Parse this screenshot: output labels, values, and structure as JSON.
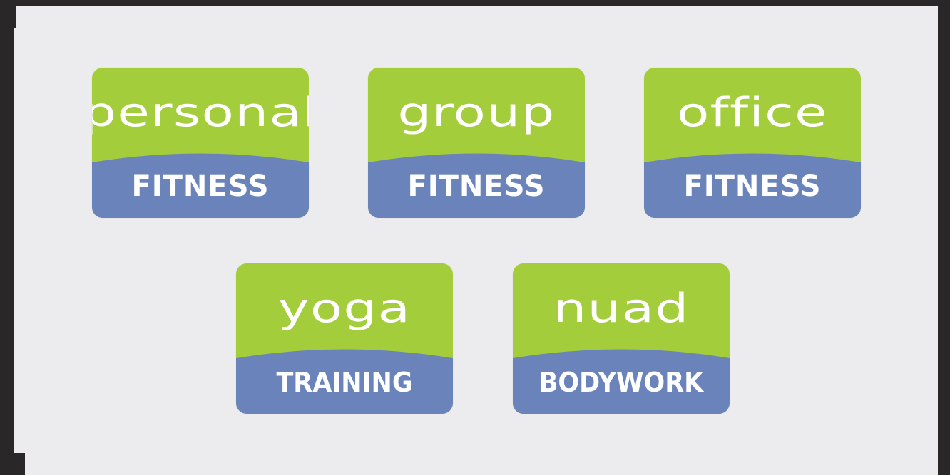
{
  "colors": {
    "green": "#a3cd3b",
    "blue": "#6a84bb",
    "text": "#ffffff",
    "canvas": "#ececee",
    "frame": "#2a2728"
  },
  "badges": [
    {
      "top": "personal",
      "bottom": "FITNESS"
    },
    {
      "top": "group",
      "bottom": "FITNESS"
    },
    {
      "top": "office",
      "bottom": "FITNESS"
    },
    {
      "top": "yoga",
      "bottom": "TRAINING"
    },
    {
      "top": "nuad",
      "bottom": "BODYWORK"
    }
  ]
}
